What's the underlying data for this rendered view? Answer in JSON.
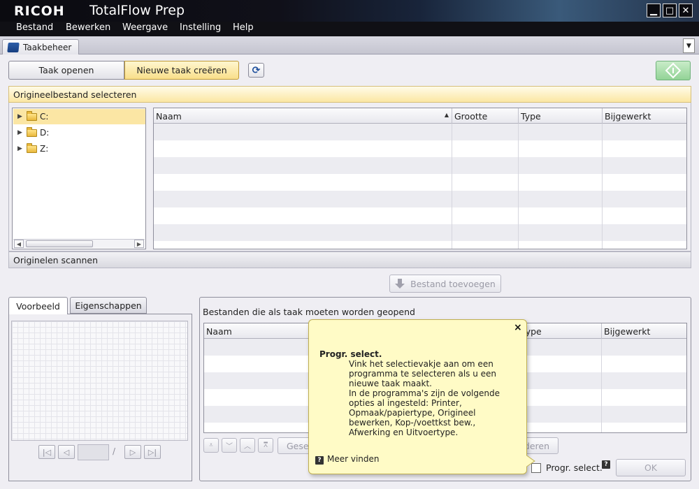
{
  "titlebar": {
    "logo": "RICOH",
    "app_title": "TotalFlow Prep",
    "minimize_label": "▁",
    "maximize_label": "□",
    "close_label": "✕"
  },
  "menu": {
    "items": [
      "Bestand",
      "Bewerken",
      "Weergave",
      "Instelling",
      "Help"
    ]
  },
  "main_tab": {
    "label": "Taakbeheer"
  },
  "toolbar": {
    "open_job": "Taak openen",
    "new_job": "Nieuwe taak creëren"
  },
  "select_section": {
    "title": "Origineelbestand selecteren",
    "drives": [
      "C:",
      "D:",
      "Z:"
    ],
    "columns": [
      "Naam",
      "Grootte",
      "Type",
      "Bijgewerkt"
    ]
  },
  "scan_section": {
    "title": "Originelen scannen"
  },
  "add_file_button": "Bestand toevoegen",
  "preview": {
    "tab_preview": "Voorbeeld",
    "tab_properties": "Eigenschappen",
    "page_separator": "/"
  },
  "open_files": {
    "label": "Bestanden die als taak moeten worden geopend",
    "columns": [
      "Naam",
      "Type",
      "Bijgewerkt"
    ],
    "selected_button_partial": "Gesel",
    "other_button_partial": "deren",
    "program_select_label": "Progr. select.",
    "ok_label": "OK"
  },
  "tooltip": {
    "title": "Progr. select.",
    "body_lines": [
      "Vink het selectievakje aan om een",
      "programma te selecteren als u een",
      "nieuwe taak maakt.",
      "In de programma's zijn de volgende",
      "opties al ingesteld: Printer,",
      "Opmaak/papiertype, Origineel",
      "bewerken, Kop-/voettkst bew.,",
      "Afwerking en Uitvoertype."
    ],
    "link": "Meer vinden",
    "close": "×"
  },
  "colors": {
    "accent_yellow": "#fbe6a4",
    "start_green": "#92d396",
    "tooltip_bg": "#fffbc6"
  }
}
